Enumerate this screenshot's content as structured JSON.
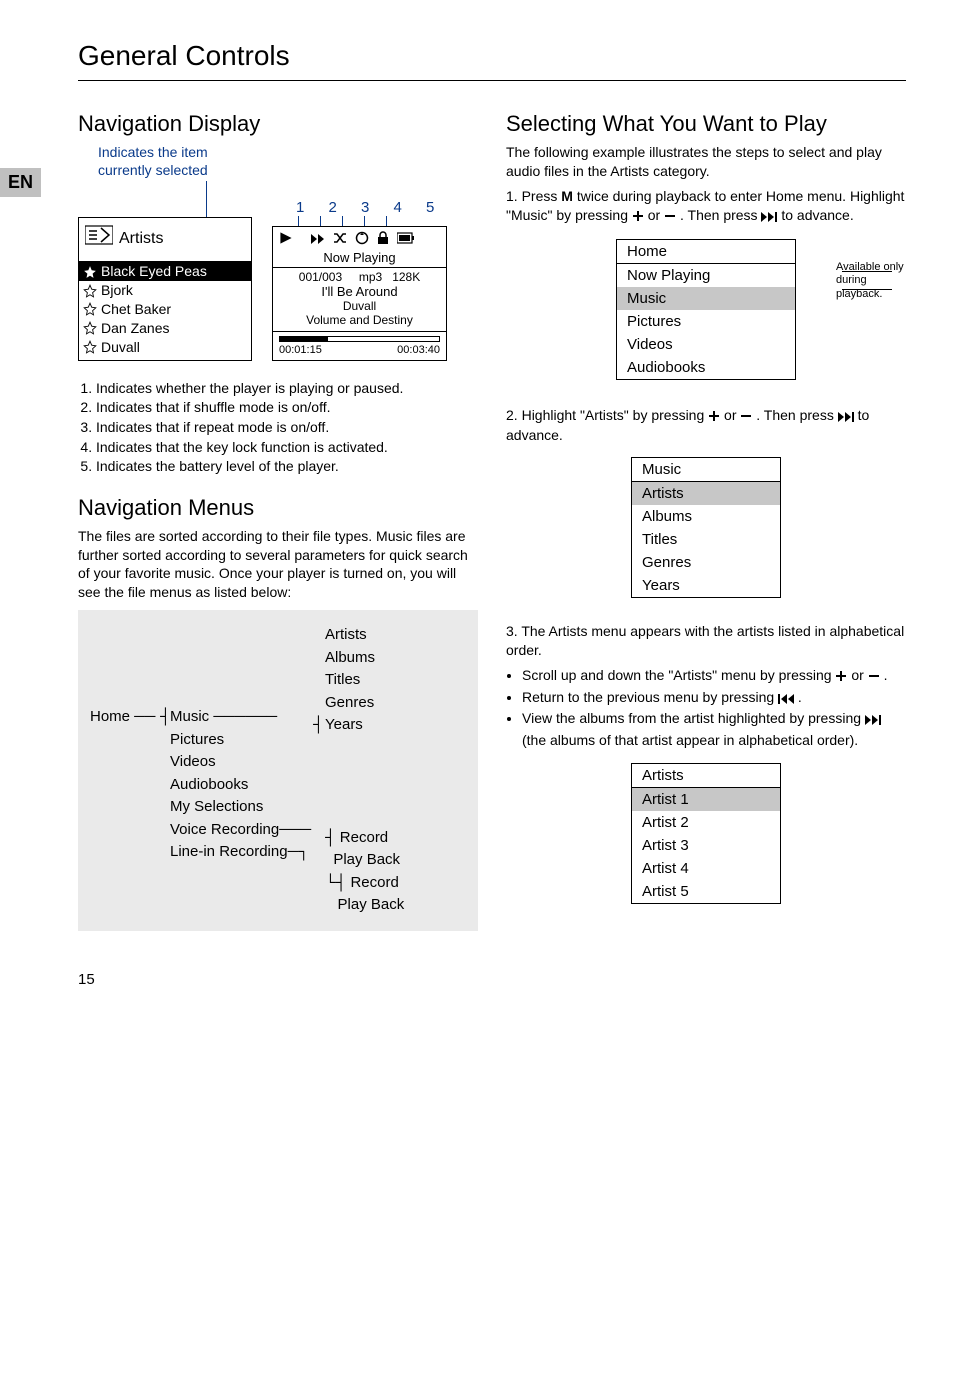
{
  "page": {
    "language_tag": "EN",
    "chapter_title": "General Controls",
    "page_number": "15"
  },
  "left": {
    "section1_title": "Navigation Display",
    "indicator_text_l1": "Indicates the item",
    "indicator_text_l2": "currently selected",
    "artists_box": {
      "category": "Artists",
      "selected": "Black Eyed Peas",
      "items": [
        "Bjork",
        "Chet Baker",
        "Dan Zanes",
        "Duvall"
      ]
    },
    "callout_numbers": "1 2 3 4 5",
    "now_playing": {
      "title": "Now Playing",
      "counter": "001/003",
      "format": "mp3",
      "bitrate": "128K",
      "song": "I'll Be Around",
      "artist": "Duvall",
      "album": "Volume and Destiny",
      "elapsed": "00:01:15",
      "total": "00:03:40"
    },
    "legend": [
      "Indicates whether the player is playing or paused.",
      "Indicates that if shuffle mode is on/off.",
      "Indicates that if repeat mode is on/off.",
      "Indicates that the key lock function is activated.",
      "Indicates the battery level of the player."
    ],
    "section2_title": "Navigation Menus",
    "section2_body": "The files are sorted according to their file types. Music files are further sorted according to several parameters for quick search of your favorite music. Once your player is turned on, you will see the file menus as listed below:",
    "tree": {
      "root": "Home",
      "level2": [
        "Music",
        "Pictures",
        "Videos",
        "Audiobooks",
        "My Selections",
        "Voice Recording",
        "Line-in Recording"
      ],
      "music_children": [
        "Artists",
        "Albums",
        "Titles",
        "Genres",
        "Years"
      ],
      "voice_children": [
        "Record",
        "Play Back"
      ],
      "linein_children": [
        "Record",
        "Play Back"
      ]
    }
  },
  "right": {
    "section_title": "Selecting What You Want to Play",
    "intro": "The following example illustrates the steps to select and play audio files in the Artists category.",
    "step1_a": "Press ",
    "step1_key": "M",
    "step1_b": " twice during playback to enter Home menu. Highlight \"Music\" by pressing ",
    "step1_c": " or ",
    "step1_d": " . Then press ",
    "step1_e": " to advance.",
    "home_menu": {
      "header": "Home",
      "items": [
        "Now Playing",
        "Music",
        "Pictures",
        "Videos",
        "Audiobooks"
      ],
      "highlight_index": 1
    },
    "side_note": "Available only during playback.",
    "step2_a": "Highlight \"Artists\" by pressing ",
    "step2_b": " or ",
    "step2_c": " . Then press ",
    "step2_d": " to advance.",
    "music_menu": {
      "header": "Music",
      "items": [
        "Artists",
        "Albums",
        "Titles",
        "Genres",
        "Years"
      ],
      "highlight_index": 0
    },
    "step3": "The Artists menu appears with the artists listed in alphabetical order.",
    "bullets": {
      "b1_a": "Scroll up and down the \"Artists\" menu by pressing ",
      "b1_b": " or ",
      "b1_c": " .",
      "b2_a": "Return to the previous menu by pressing ",
      "b2_b": " .",
      "b3_a": "View the albums from the artist highlighted by pressing ",
      "b3_b": " (the albums of that artist appear in alphabetical order)."
    },
    "artists_menu": {
      "header": "Artists",
      "items": [
        "Artist 1",
        "Artist 2",
        "Artist 3",
        "Artist 4",
        "Artist 5"
      ],
      "highlight_index": 0
    }
  }
}
